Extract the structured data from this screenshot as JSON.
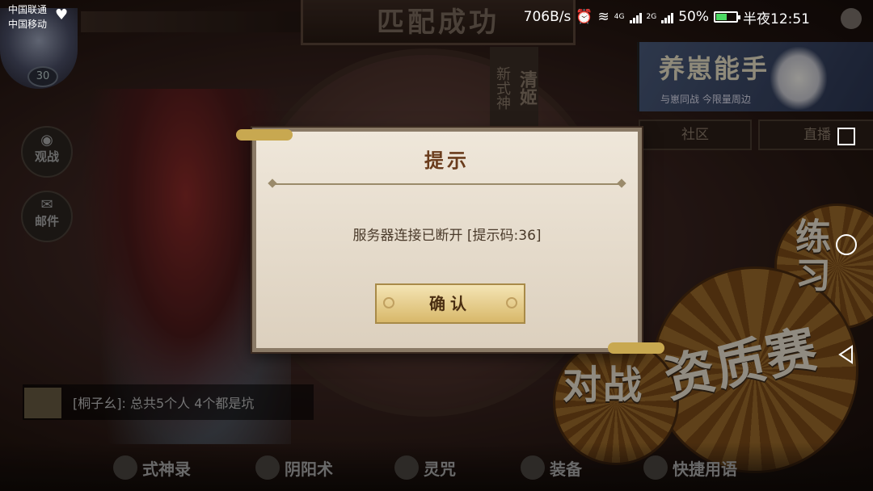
{
  "status_bar": {
    "carrier_1": "中国联通",
    "carrier_2": "中国移动",
    "speed": "706B/s",
    "net_4g": "4G",
    "net_2g": "2G",
    "battery": "50%",
    "battery_level": 0.5,
    "time": "半夜12:51"
  },
  "game": {
    "match_title": "匹配成功",
    "new_shikigami_label": "新式神",
    "new_shikigami_name": "清姬",
    "player_name": "",
    "player_level": "30",
    "side_buttons": {
      "watch_label": "观战",
      "mail_label": "邮件"
    },
    "ad": {
      "title": "养崽能手",
      "subtitle": "与崽同战 今限量周边"
    },
    "tabs": {
      "community": "社区",
      "live": "直播"
    },
    "modes": {
      "practice": "练习",
      "qualifier": "资质赛",
      "battle": "对战"
    },
    "chat": {
      "message": "[桐子幺]: 总共5个人 4个都是坑"
    },
    "bottom_nav": {
      "shikigami_record": "式神录",
      "onmyoji_skills": "阴阳术",
      "spell": "灵咒",
      "equipment": "装备",
      "quick_phrases": "快捷用语"
    }
  },
  "dialog": {
    "title": "提示",
    "message": "服务器连接已断开 [提示码:36]",
    "confirm_label": "确认"
  },
  "colors": {
    "dialog_bg": "#efe7da",
    "dialog_title": "#6a3c1c",
    "confirm_bg": "#e8cf8c"
  }
}
